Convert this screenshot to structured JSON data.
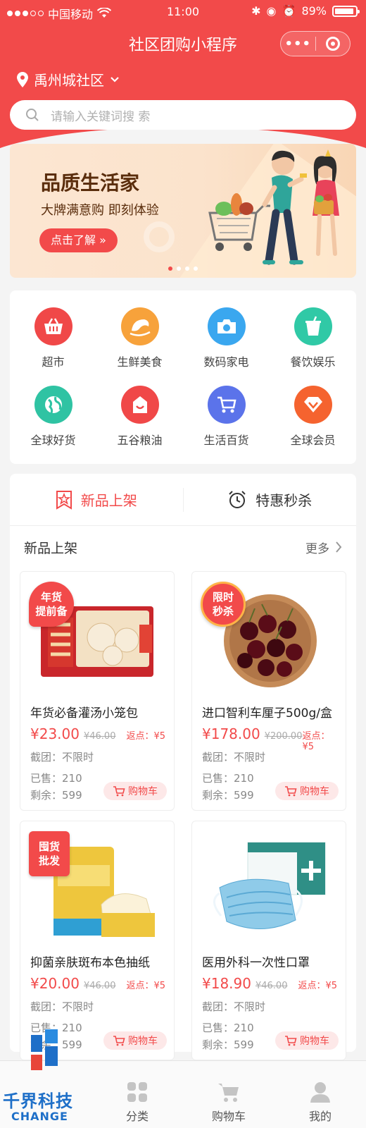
{
  "status_bar": {
    "carrier": "中国移动",
    "time": "11:00",
    "battery": "89%"
  },
  "nav": {
    "title": "社区团购小程序",
    "more_icon": "more-dots-icon",
    "close_icon": "target-icon"
  },
  "location": {
    "name": "禹州城社区"
  },
  "search": {
    "placeholder": "请输入关键词搜 索"
  },
  "banner": {
    "title": "品质生活家",
    "subtitle": "大牌满意购 即刻体验",
    "button": "点击了解 »",
    "pages": 4,
    "active_page": 1
  },
  "categories": [
    {
      "label": "超市",
      "icon": "basket-icon",
      "color": "#f04848"
    },
    {
      "label": "生鲜美食",
      "icon": "seafood-icon",
      "color": "#f7a23b"
    },
    {
      "label": "数码家电",
      "icon": "camera-icon",
      "color": "#3aa7ef"
    },
    {
      "label": "餐饮娱乐",
      "icon": "drink-cup-icon",
      "color": "#30c9a6"
    },
    {
      "label": "全球好货",
      "icon": "globe-icon",
      "color": "#2fc3a3"
    },
    {
      "label": "五谷粮油",
      "icon": "grain-bag-icon",
      "color": "#f04848"
    },
    {
      "label": "生活百货",
      "icon": "cart-icon",
      "color": "#5b73ea"
    },
    {
      "label": "全球会员",
      "icon": "diamond-icon",
      "color": "#f5632f"
    }
  ],
  "tabs": [
    {
      "label": "新品上架",
      "icon": "star-badge-icon",
      "active": true
    },
    {
      "label": "特惠秒杀",
      "icon": "alarm-clock-icon",
      "active": false
    }
  ],
  "section": {
    "title": "新品上架",
    "more": "更多"
  },
  "products": [
    {
      "badge": [
        "年货",
        "提前备"
      ],
      "name": "年货必备灌汤小笼包",
      "price": "¥23.00",
      "old_price": "¥46.00",
      "rebate": "返点：¥5",
      "deadline": "截团：不限时",
      "sold": "已售：210",
      "left": "剩余：599",
      "cart": "购物车"
    },
    {
      "badge": [
        "限时",
        "秒杀"
      ],
      "name": "进口智利车厘子500g/盒",
      "price": "¥178.00",
      "old_price": "¥200.00",
      "rebate": "返点：¥5",
      "deadline": "截团：不限时",
      "sold": "已售：210",
      "left": "剩余：599",
      "cart": "购物车"
    },
    {
      "badge": [
        "囤货",
        "批发"
      ],
      "name": "抑菌亲肤斑布本色抽纸",
      "price": "¥20.00",
      "old_price": "¥46.00",
      "rebate": "返点：¥5",
      "deadline": "截团：不限时",
      "sold": "已售：210",
      "left": "剩余：599",
      "cart": "购物车"
    },
    {
      "badge": [],
      "name": "医用外科一次性口罩",
      "price": "¥18.90",
      "old_price": "¥46.00",
      "rebate": "返点：¥5",
      "deadline": "截团：不限时",
      "sold": "已售：210",
      "left": "剩余：599",
      "cart": "购物车"
    }
  ],
  "bottom_nav": [
    {
      "label": "",
      "icon": "home-icon"
    },
    {
      "label": "分类",
      "icon": "grid-icon"
    },
    {
      "label": "购物车",
      "icon": "cart-icon"
    },
    {
      "label": "我的",
      "icon": "user-icon"
    }
  ],
  "watermark": {
    "cn": "千界科技",
    "en": "CHANGE"
  },
  "colors": {
    "brand": "#f24a4a",
    "bg": "#f4f4f4"
  }
}
